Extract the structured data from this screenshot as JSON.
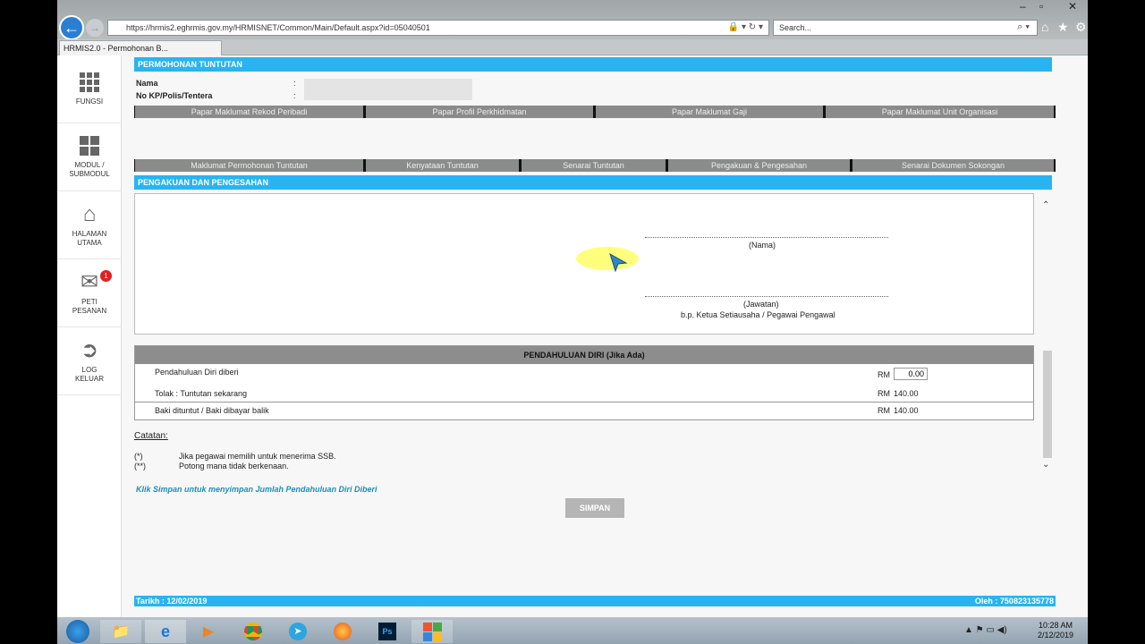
{
  "browser": {
    "url": "https://hrmis2.eghrmis.gov.my/HRMISNET/Common/Main/Default.aspx?id=05040501",
    "search_placeholder": "Search...",
    "tab_title": "HRMIS2.0 - Permohonan B..."
  },
  "sidebar": {
    "items": [
      {
        "label": "FUNGSI"
      },
      {
        "label": "MODUL / SUBMODUL"
      },
      {
        "label": "HALAMAN UTAMA"
      },
      {
        "label": "PETI PESANAN",
        "badge": "1"
      },
      {
        "label": "LOG KELUAR"
      }
    ]
  },
  "header": {
    "title": "PERMOHONAN TUNTUTAN",
    "nama_label": "Nama",
    "nokp_label": "No KP/Polis/Tentera",
    "colon": ":"
  },
  "profile_tabs": [
    "Papar Maklumat Rekod Peribadi",
    "Papar Profil Perkhidmatan",
    "Papar Maklumat Gaji",
    "Papar Maklumat Unit Organisasi"
  ],
  "claim_tabs": [
    "Maklumat Permohonan Tuntutan",
    "Kenyataan Tuntutan",
    "Senarai Tuntutan",
    "Pengakuan & Pengesahan",
    "Senarai Dokumen Sokongan"
  ],
  "section_title": "PENGAKUAN DAN PENGESAHAN",
  "signature": {
    "nama": "(Nama)",
    "jawatan": "(Jawatan)",
    "behalf": "b.p. Ketua Setiausaha / Pegawai Pengawal"
  },
  "advance": {
    "title": "PENDAHULUAN DIRI (Jika Ada)",
    "rows": [
      {
        "label": "Pendahuluan Diri diberi",
        "currency": "RM",
        "value": "0.00"
      },
      {
        "label": "Tolak : Tuntutan sekarang",
        "currency": "RM",
        "value": "140.00"
      },
      {
        "label": "Baki dituntut / Baki dibayar balik",
        "currency": "RM",
        "value": "140.00"
      }
    ]
  },
  "notes": {
    "title": "Catatan:",
    "items": [
      {
        "mark": "(*)",
        "text": "Jika pegawai memilih untuk menerima SSB."
      },
      {
        "mark": "(**)",
        "text": "Potong mana tidak berkenaan."
      }
    ],
    "hint": "Klik Simpan untuk menyimpan Jumlah Pendahuluan Diri Diberi"
  },
  "save_label": "SIMPAN",
  "footer": {
    "date": "Tarikh : 12/02/2019",
    "by": "Oleh : 750823135778"
  },
  "taskbar": {
    "time": "10:28 AM",
    "date": "2/12/2019"
  },
  "colors": {
    "accent": "#29b4f1",
    "tab_gray": "#8b8b8b"
  }
}
